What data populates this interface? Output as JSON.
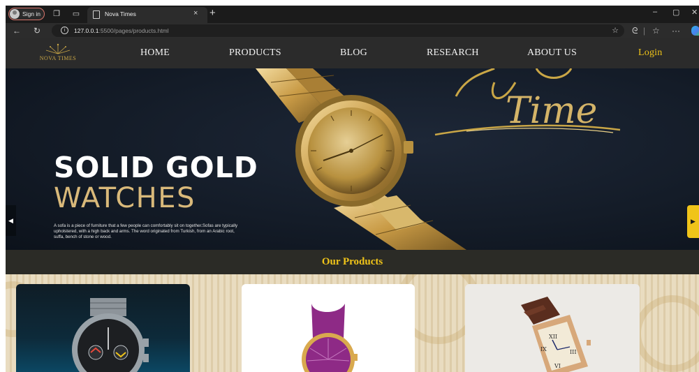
{
  "browser": {
    "signin_label": "Sign in",
    "tab_title": "Nova Times",
    "tab_close": "×",
    "new_tab": "+",
    "url_host": "127.0.0.1",
    "url_path": ":5500/pages/products.html"
  },
  "site": {
    "logo_text": "NOVA TIMES",
    "nav": {
      "home": "HOME",
      "products": "PRODUCTS",
      "blog": "BLOG",
      "research": "RESEARCH",
      "about": "ABOUT US",
      "login": "Login"
    }
  },
  "hero": {
    "script_text": "Time",
    "title": "SOLID GOLD",
    "subtitle": "WATCHES",
    "description": "A sofa is a piece of furniture that a few people can comfortably sit on together.Sofas are typically upholstered, with a high back and arms. The word originated from Turkish, from an Arabic root, suffa, bench of stone or wood."
  },
  "products": {
    "heading": "Our Products"
  },
  "colors": {
    "accent_gold": "#f0c419",
    "nav_bg": "#2b2b2b",
    "hero_subtitle": "#d9b97a"
  }
}
